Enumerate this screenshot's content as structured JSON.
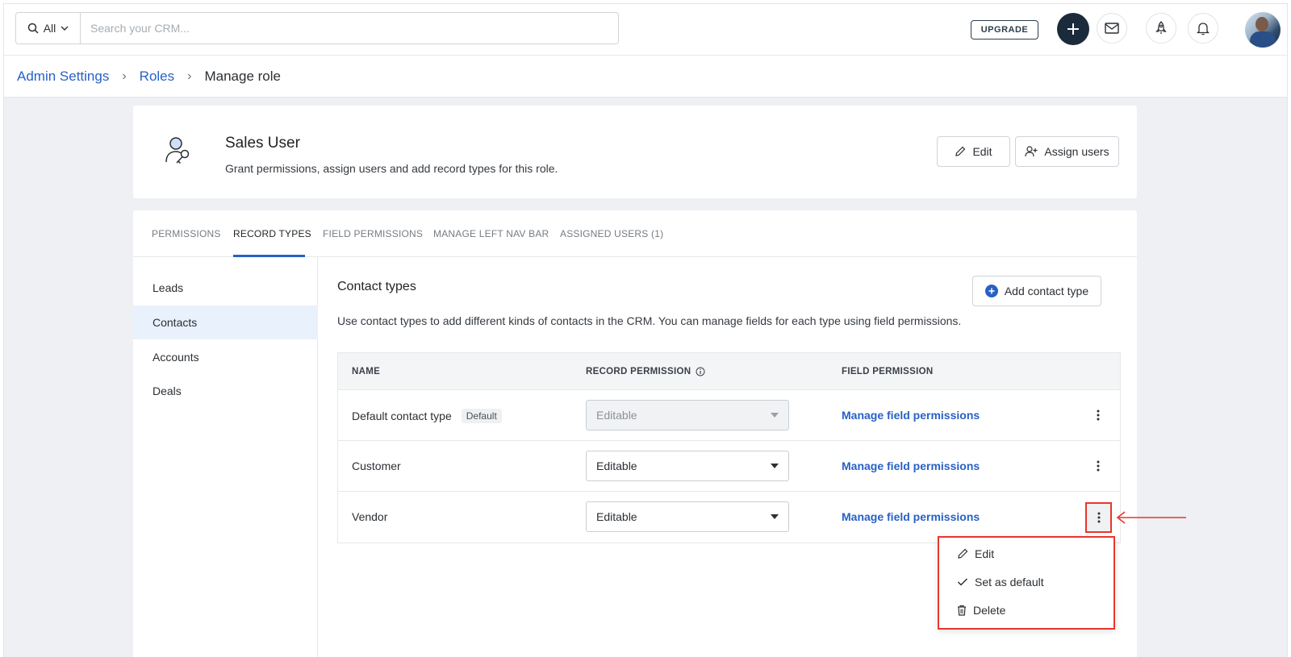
{
  "topbar": {
    "search_scope": "All",
    "search_placeholder": "Search your CRM...",
    "upgrade_label": "UPGRADE"
  },
  "breadcrumb": {
    "items": [
      "Admin Settings",
      "Roles",
      "Manage role"
    ]
  },
  "role": {
    "title": "Sales User",
    "description": "Grant permissions, assign users and add record types for this role.",
    "edit_label": "Edit",
    "assign_label": "Assign users"
  },
  "tabs": [
    "PERMISSIONS",
    "RECORD TYPES",
    "FIELD PERMISSIONS",
    "MANAGE LEFT NAV BAR",
    "ASSIGNED USERS (1)"
  ],
  "active_tab": "RECORD TYPES",
  "leftnav": [
    "Leads",
    "Contacts",
    "Accounts",
    "Deals"
  ],
  "active_nav": "Contacts",
  "section": {
    "title": "Contact types",
    "description": "Use contact types to add different kinds of contacts in the CRM. You can manage fields for each type using field permissions.",
    "add_label": "Add contact type"
  },
  "table": {
    "headers": [
      "NAME",
      "RECORD PERMISSION",
      "FIELD PERMISSION"
    ],
    "rows": [
      {
        "name": "Default contact type",
        "badge": "Default",
        "permission": "Editable",
        "disabled": true,
        "link": "Manage field permissions"
      },
      {
        "name": "Customer",
        "badge": "",
        "permission": "Editable",
        "disabled": false,
        "link": "Manage field permissions"
      },
      {
        "name": "Vendor",
        "badge": "",
        "permission": "Editable",
        "disabled": false,
        "link": "Manage field permissions"
      }
    ]
  },
  "menu": {
    "edit": "Edit",
    "set_default": "Set as default",
    "delete": "Delete"
  },
  "colors": {
    "accent": "#2861c5",
    "highlight": "#e8362c",
    "dark": "#1b2b3b"
  }
}
